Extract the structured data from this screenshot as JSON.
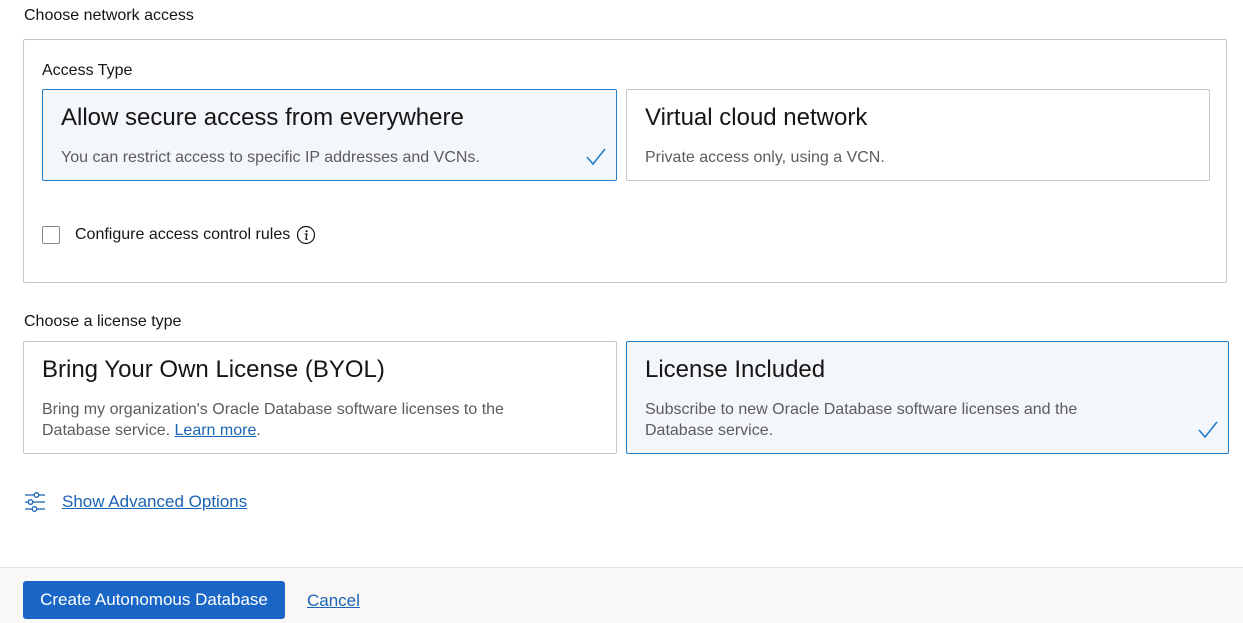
{
  "network_section": {
    "title": "Choose network access",
    "access_type_label": "Access Type",
    "options": [
      {
        "title": "Allow secure access from everywhere",
        "description": "You can restrict access to specific IP addresses and VCNs.",
        "selected": true
      },
      {
        "title": "Virtual cloud network",
        "description": "Private access only, using a VCN.",
        "selected": false
      }
    ],
    "access_control_checkbox": {
      "label": "Configure access control rules",
      "checked": false
    }
  },
  "license_section": {
    "title": "Choose a license type",
    "options": [
      {
        "title": "Bring Your Own License (BYOL)",
        "description": "Bring my organization's Oracle Database software licenses to the Database service.",
        "link_text": "Learn more",
        "link_suffix": ".",
        "selected": false
      },
      {
        "title": "License Included",
        "description": "Subscribe to new Oracle Database software licenses and the Database service.",
        "selected": true
      }
    ]
  },
  "advanced_options": {
    "label": "Show Advanced Options",
    "icon": "sliders-icon"
  },
  "footer": {
    "create_button_label": "Create Autonomous Database",
    "cancel_label": "Cancel"
  },
  "colors": {
    "primary": "#1a66c7",
    "link": "#1a64b3",
    "selected_border": "#227ecb",
    "selected_bg": "#f3f7fb"
  }
}
